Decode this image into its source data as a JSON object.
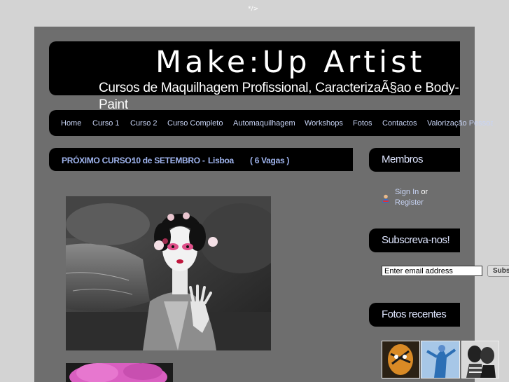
{
  "top_mark": "*/>",
  "header": {
    "title": "Make:Up Artist",
    "tagline": "Cursos de Maquilhagem Profissional, CaracterizaÃ§ao e Body-Paint"
  },
  "nav": [
    {
      "label": "Home"
    },
    {
      "label": "Curso 1"
    },
    {
      "label": "Curso 2"
    },
    {
      "label": "Curso Completo"
    },
    {
      "label": "Automaquilhagem"
    },
    {
      "label": "Workshops"
    },
    {
      "label": "Fotos"
    },
    {
      "label": "Contactos"
    },
    {
      "label": "Valorização Pessoal"
    }
  ],
  "announcement": {
    "prefix": "PRÓXIMO CURSO:",
    "date": "10 de SETEMBRO -",
    "city": "Lisboa",
    "vacancies": "( 6 Vagas )"
  },
  "sidebar": {
    "members": {
      "title": "Membros",
      "sign_in": "Sign In",
      "or": "or",
      "register": "Register"
    },
    "subscribe": {
      "title": "Subscreva-nos!",
      "email_placeholder": "Enter email address",
      "button": "Subs"
    },
    "photos": {
      "title": "Fotos recentes"
    }
  },
  "colors": {
    "page_bg": "#d3d3d3",
    "content_bg": "#6e6e6e",
    "bar_bg": "#000000",
    "nav_link": "#c8d4f5",
    "announcement_text": "#9fb4ee"
  }
}
